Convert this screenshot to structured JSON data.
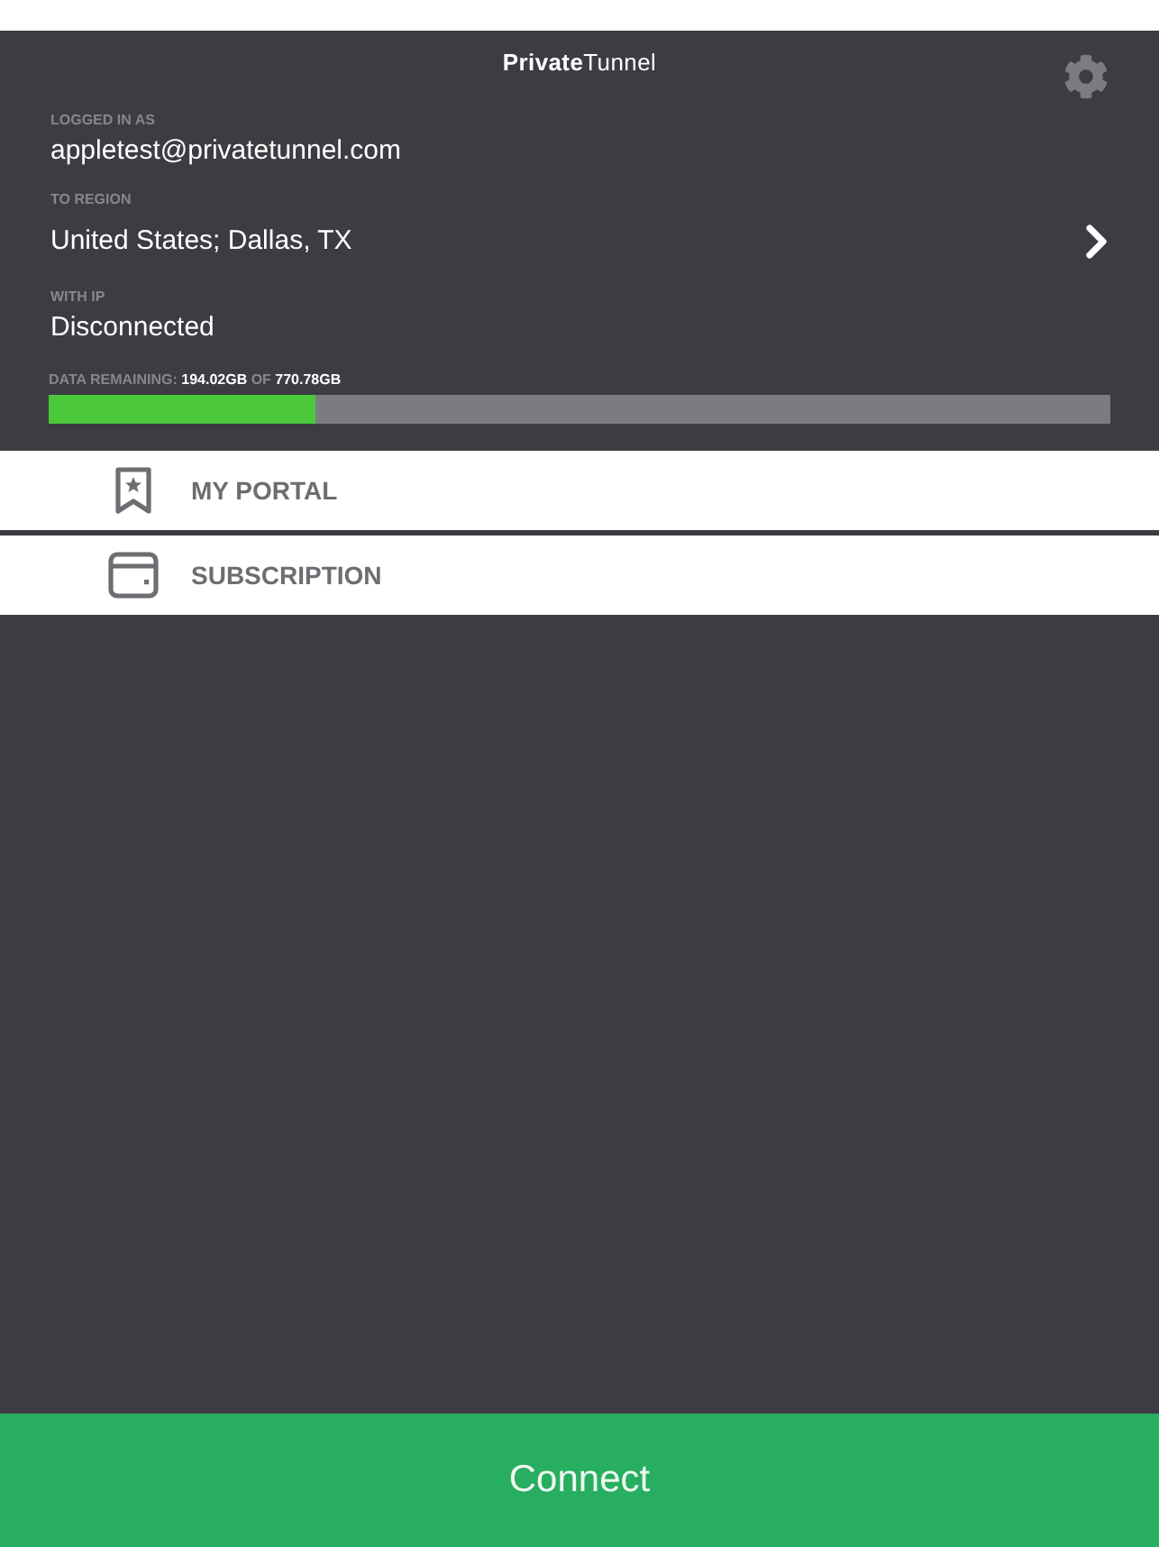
{
  "header": {
    "logo": "**Private**Tunnel"
  },
  "account": {
    "label": "LOGGED IN AS",
    "value": "appletest@privatetunnel.com"
  },
  "region": {
    "label": "TO REGION",
    "value": "United States; Dallas, TX"
  },
  "ip": {
    "label": "WITH IP",
    "value": "Disconnected"
  },
  "data_usage": {
    "text": "DATA REMAINING: **194.02GB** OF **770.78GB**",
    "level": 0.251
  },
  "menu": [
    {
      "kind": "portal",
      "label": "MY PORTAL"
    },
    {
      "kind": "subscription",
      "label": "SUBSCRIPTION"
    }
  ],
  "connect_button": {
    "label": "Connect"
  }
}
